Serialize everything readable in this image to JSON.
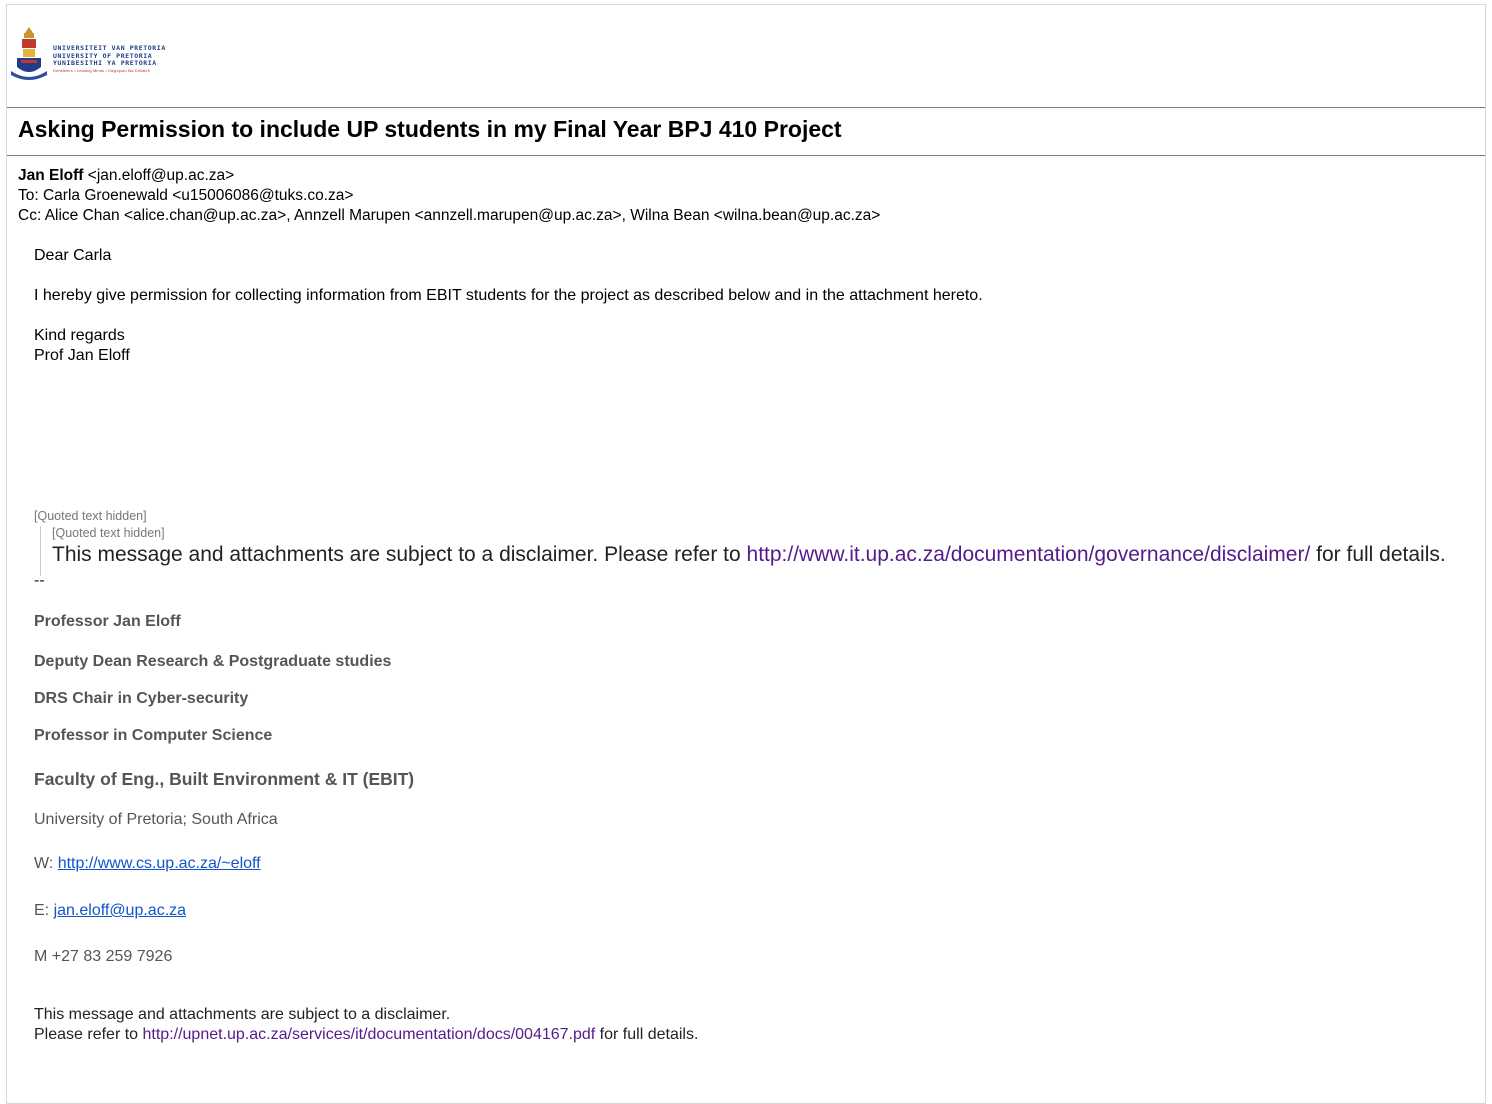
{
  "header": {
    "logo_lines": [
      "UNIVERSITEIT VAN PRETORIA",
      "UNIVERSITY OF PRETORIA",
      "YUNIBESITHI YA PRETORIA"
    ],
    "logo_motto": "Denkleiers • Leading Minds • Dikgopolo tša Dihlalefi"
  },
  "email": {
    "subject": "Asking Permission to include UP students in my Final Year BPJ 410 Project",
    "from_name": "Jan Eloff",
    "from_addr": "<jan.eloff@up.ac.za>",
    "to": "To: Carla Groenewald <u15006086@tuks.co.za>",
    "cc": "Cc: Alice Chan <alice.chan@up.ac.za>, Annzell Marupen <annzell.marupen@up.ac.za>, Wilna Bean <wilna.bean@up.ac.za>",
    "greeting": "Dear Carla",
    "paragraph": "I hereby give permission for collecting information from EBIT students for the project as described below and in the attachment hereto.",
    "closing": "Kind regards",
    "signoff": "Prof Jan Eloff",
    "quoted_hidden_1": "[Quoted text hidden]",
    "quoted_hidden_2": "[Quoted text hidden]",
    "disclaimer_pre": "This message and attachments are subject to a disclaimer. Please refer to ",
    "disclaimer_link": "http://www.it.up.ac.za/documentation/governance/disclaimer/",
    "disclaimer_post": " for full details.",
    "dashes": "--"
  },
  "signature": {
    "name": "Professor Jan Eloff",
    "title1": "Deputy Dean Research & Postgraduate studies",
    "title2": "DRS Chair in Cyber-security",
    "title3": "Professor in Computer Science",
    "faculty": "Faculty of Eng., Built Environment & IT (EBIT)",
    "university": "University of Pretoria; South Africa",
    "web_label": "W: ",
    "web_link": "http://www.cs.up.ac.za/~eloff",
    "email_label": "E:  ",
    "email_link": "jan.eloff@up.ac.za",
    "mobile": "M +27 83 259 7926"
  },
  "footer": {
    "line1": "This message and attachments are subject to a disclaimer.",
    "line2_pre": "Please refer to ",
    "line2_link": "http://upnet.up.ac.za/services/it/documentation/docs/004167.pdf",
    "line2_post": " for full details."
  }
}
